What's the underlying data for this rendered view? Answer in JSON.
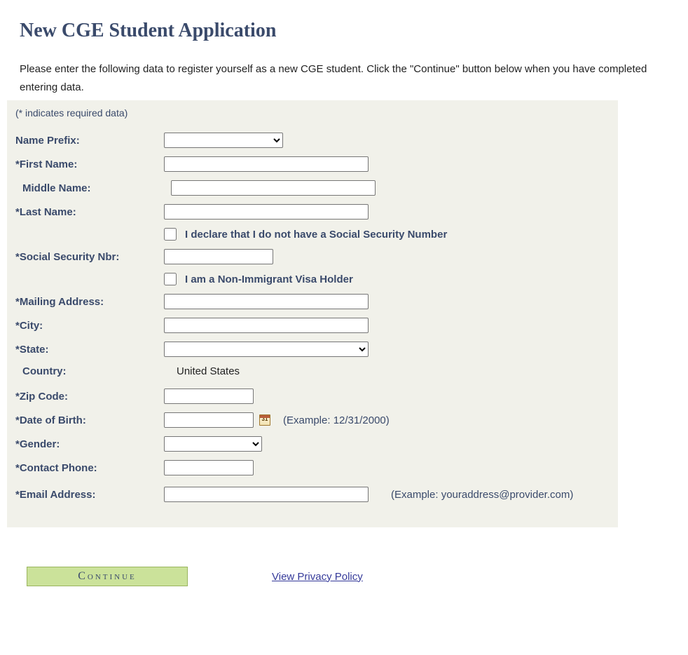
{
  "title": "New CGE Student Application",
  "intro": "Please enter the following data to register yourself as a new CGE student. Click the \"Continue\" button below when you have completed entering data.",
  "required_note": "(* indicates required data)",
  "labels": {
    "name_prefix": "Name Prefix:",
    "first_name": "*First Name:",
    "middle_name": "Middle Name:",
    "last_name": "*Last Name:",
    "ssn": "*Social Security Nbr:",
    "mailing_address": "*Mailing Address:",
    "city": "*City:",
    "state": "*State:",
    "country": "Country:",
    "zip": "*Zip Code:",
    "dob": "*Date of Birth:",
    "gender": "*Gender:",
    "phone": "*Contact Phone:",
    "email": "*Email Address:"
  },
  "checkboxes": {
    "no_ssn": "I declare that I do not have a Social Security Number",
    "visa": "I am a Non-Immigrant Visa Holder"
  },
  "country_value": "United States",
  "dob_hint": "(Example: 12/31/2000)",
  "email_hint": "(Example: youraddress@provider.com)",
  "calendar_icon_text": "31",
  "continue_label": "Continue",
  "privacy_label": "View Privacy Policy"
}
